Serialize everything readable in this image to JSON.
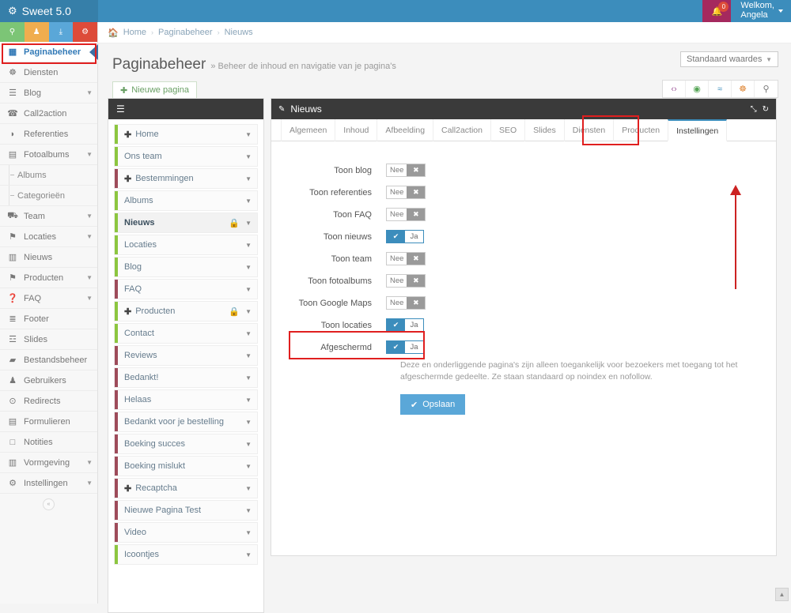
{
  "topbar": {
    "brand": "Sweet 5.0",
    "brand_icon": "gears-icon",
    "notification_count": "0",
    "welcome_line1": "Welkom,",
    "welcome_line2": "Angela"
  },
  "quick_buttons": [
    {
      "name": "map-marker",
      "glyph": "♀",
      "color": "#7cc576"
    },
    {
      "name": "user",
      "glyph": "♟",
      "color": "#f0ad4e"
    },
    {
      "name": "download",
      "glyph": "⤓",
      "color": "#5aa7d8"
    },
    {
      "name": "gears",
      "glyph": "⚙",
      "color": "#dd4b39"
    }
  ],
  "sidebar": {
    "items": [
      {
        "label": "Paginabeheer",
        "icon": "table-icon",
        "glyph": "▦",
        "active": true,
        "chevron": false,
        "sub": false
      },
      {
        "label": "Diensten",
        "icon": "sitemap-icon",
        "glyph": "☸",
        "active": false,
        "chevron": false,
        "sub": false
      },
      {
        "label": "Blog",
        "icon": "file-icon",
        "glyph": "☰",
        "active": false,
        "chevron": true,
        "sub": false
      },
      {
        "label": "Call2action",
        "icon": "phone-icon",
        "glyph": "☎",
        "active": false,
        "chevron": false,
        "sub": false
      },
      {
        "label": "Referenties",
        "icon": "comment-icon",
        "glyph": "◗",
        "active": false,
        "chevron": false,
        "sub": false
      },
      {
        "label": "Fotoalbums",
        "icon": "book-icon",
        "glyph": "▤",
        "active": false,
        "chevron": true,
        "sub": false
      },
      {
        "label": "Albums",
        "icon": "",
        "glyph": "",
        "active": false,
        "chevron": false,
        "sub": true
      },
      {
        "label": "Categorieën",
        "icon": "",
        "glyph": "",
        "active": false,
        "chevron": false,
        "sub": true
      },
      {
        "label": "Team",
        "icon": "users-icon",
        "glyph": "⛟",
        "active": false,
        "chevron": true,
        "sub": false
      },
      {
        "label": "Locaties",
        "icon": "map-marker-icon",
        "glyph": "⚑",
        "active": false,
        "chevron": true,
        "sub": false
      },
      {
        "label": "Nieuws",
        "icon": "newspaper-icon",
        "glyph": "▥",
        "active": false,
        "chevron": false,
        "sub": false
      },
      {
        "label": "Producten",
        "icon": "tags-icon",
        "glyph": "⚑",
        "active": false,
        "chevron": true,
        "sub": false
      },
      {
        "label": "FAQ",
        "icon": "question-circle-icon",
        "glyph": "❓",
        "active": false,
        "chevron": true,
        "sub": false
      },
      {
        "label": "Footer",
        "icon": "list-alt-icon",
        "glyph": "≣",
        "active": false,
        "chevron": false,
        "sub": false
      },
      {
        "label": "Slides",
        "icon": "sliders-icon",
        "glyph": "☲",
        "active": false,
        "chevron": false,
        "sub": false
      },
      {
        "label": "Bestandsbeheer",
        "icon": "folder-icon",
        "glyph": "▰",
        "active": false,
        "chevron": false,
        "sub": false
      },
      {
        "label": "Gebruikers",
        "icon": "user-icon",
        "glyph": "♟",
        "active": false,
        "chevron": false,
        "sub": false
      },
      {
        "label": "Redirects",
        "icon": "arrow-circle-icon",
        "glyph": "⊙",
        "active": false,
        "chevron": false,
        "sub": false
      },
      {
        "label": "Formulieren",
        "icon": "form-icon",
        "glyph": "▤",
        "active": false,
        "chevron": false,
        "sub": false
      },
      {
        "label": "Notities",
        "icon": "note-icon",
        "glyph": "□",
        "active": false,
        "chevron": false,
        "sub": false
      },
      {
        "label": "Vormgeving",
        "icon": "columns-icon",
        "glyph": "▥",
        "active": false,
        "chevron": true,
        "sub": false
      },
      {
        "label": "Instellingen",
        "icon": "cog-icon",
        "glyph": "⚙",
        "active": false,
        "chevron": true,
        "sub": false
      }
    ],
    "collapse_glyph": "«"
  },
  "breadcrumb": {
    "home_icon": "home-icon",
    "items": [
      "Home",
      "Paginabeheer",
      "Nieuws"
    ],
    "separator": "›"
  },
  "page_head": {
    "title": "Paginabeheer",
    "subtitle": "» Beheer de inhoud en navigatie van je pagina's",
    "default_values_select": "Standaard waardes",
    "new_page_button": "Nieuwe pagina",
    "new_page_icon": "plus-icon"
  },
  "action_icons": [
    {
      "name": "code-icon",
      "glyph": "‹›",
      "color": "#a05c9d"
    },
    {
      "name": "eye-icon",
      "glyph": "◉",
      "color": "#56a556"
    },
    {
      "name": "share-icon",
      "glyph": "≈",
      "color": "#3c8dbc"
    },
    {
      "name": "sitemap-icon",
      "glyph": "☸",
      "color": "#e08a3c"
    },
    {
      "name": "search-icon",
      "glyph": "⚲",
      "color": "#777777"
    }
  ],
  "tree": {
    "header_icon": "hamburger-icon",
    "header_glyph": "☰",
    "rows": [
      {
        "label": "Home",
        "expandable": true,
        "locked": false,
        "published": true,
        "selected": false
      },
      {
        "label": "Ons team",
        "expandable": false,
        "locked": false,
        "published": true,
        "selected": false
      },
      {
        "label": "Bestemmingen",
        "expandable": true,
        "locked": false,
        "published": false,
        "selected": false
      },
      {
        "label": "Albums",
        "expandable": false,
        "locked": false,
        "published": true,
        "selected": false
      },
      {
        "label": "Nieuws",
        "expandable": false,
        "locked": true,
        "published": true,
        "selected": true
      },
      {
        "label": "Locaties",
        "expandable": false,
        "locked": false,
        "published": true,
        "selected": false
      },
      {
        "label": "Blog",
        "expandable": false,
        "locked": false,
        "published": true,
        "selected": false
      },
      {
        "label": "FAQ",
        "expandable": false,
        "locked": false,
        "published": false,
        "selected": false
      },
      {
        "label": "Producten",
        "expandable": true,
        "locked": true,
        "published": true,
        "selected": false
      },
      {
        "label": "Contact",
        "expandable": false,
        "locked": false,
        "published": true,
        "selected": false
      },
      {
        "label": "Reviews",
        "expandable": false,
        "locked": false,
        "published": false,
        "selected": false
      },
      {
        "label": "Bedankt!",
        "expandable": false,
        "locked": false,
        "published": false,
        "selected": false
      },
      {
        "label": "Helaas",
        "expandable": false,
        "locked": false,
        "published": false,
        "selected": false
      },
      {
        "label": "Bedankt voor je bestelling",
        "expandable": false,
        "locked": false,
        "published": false,
        "selected": false
      },
      {
        "label": "Boeking succes",
        "expandable": false,
        "locked": false,
        "published": false,
        "selected": false
      },
      {
        "label": "Boeking mislukt",
        "expandable": false,
        "locked": false,
        "published": false,
        "selected": false
      },
      {
        "label": "Recaptcha",
        "expandable": true,
        "locked": false,
        "published": false,
        "selected": false
      },
      {
        "label": "Nieuwe Pagina Test",
        "expandable": false,
        "locked": false,
        "published": false,
        "selected": false
      },
      {
        "label": "Video",
        "expandable": false,
        "locked": false,
        "published": false,
        "selected": false
      },
      {
        "label": "Icoontjes",
        "expandable": false,
        "locked": false,
        "published": true,
        "selected": false
      }
    ]
  },
  "panel": {
    "title": "Nieuws",
    "title_icon": "edit-icon",
    "head_icons": [
      {
        "name": "expand-icon",
        "glyph": "⤡"
      },
      {
        "name": "refresh-icon",
        "glyph": "↻"
      }
    ],
    "tabs": [
      {
        "label": "Algemeen",
        "active": false
      },
      {
        "label": "Inhoud",
        "active": false
      },
      {
        "label": "Afbeelding",
        "active": false
      },
      {
        "label": "Call2action",
        "active": false
      },
      {
        "label": "SEO",
        "active": false
      },
      {
        "label": "Slides",
        "active": false
      },
      {
        "label": "Diensten",
        "active": false
      },
      {
        "label": "Producten",
        "active": false
      },
      {
        "label": "Instellingen",
        "active": true
      }
    ],
    "toggle_labels": {
      "yes": "Ja",
      "no": "Nee",
      "yes_icon": "check-icon",
      "no_icon": "times-icon",
      "yes_glyph": "✔",
      "no_glyph": "✖"
    },
    "fields": [
      {
        "label": "Toon blog",
        "value": false
      },
      {
        "label": "Toon referenties",
        "value": false
      },
      {
        "label": "Toon FAQ",
        "value": false
      },
      {
        "label": "Toon nieuws",
        "value": true
      },
      {
        "label": "Toon team",
        "value": false
      },
      {
        "label": "Toon fotoalbums",
        "value": false
      },
      {
        "label": "Toon Google Maps",
        "value": false
      },
      {
        "label": "Toon locaties",
        "value": true
      },
      {
        "label": "Afgeschermd",
        "value": true
      }
    ],
    "help_text": "Deze en onderliggende pagina's zijn alleen toegankelijk voor bezoekers met toegang tot het afgeschermde gedeelte. Ze staan standaard op noindex en nofollow.",
    "save_button": "Opslaan",
    "save_icon": "check-icon"
  },
  "scroll_top_glyph": "▲",
  "colors": {
    "topbar": "#3c8dbc",
    "brand": "#367fa9",
    "accent": "#3c8dbc",
    "annotation": "#e01f1f",
    "published": "#8cc63f",
    "unpublished": "#9e4b5a",
    "save": "#5aa7d8"
  }
}
